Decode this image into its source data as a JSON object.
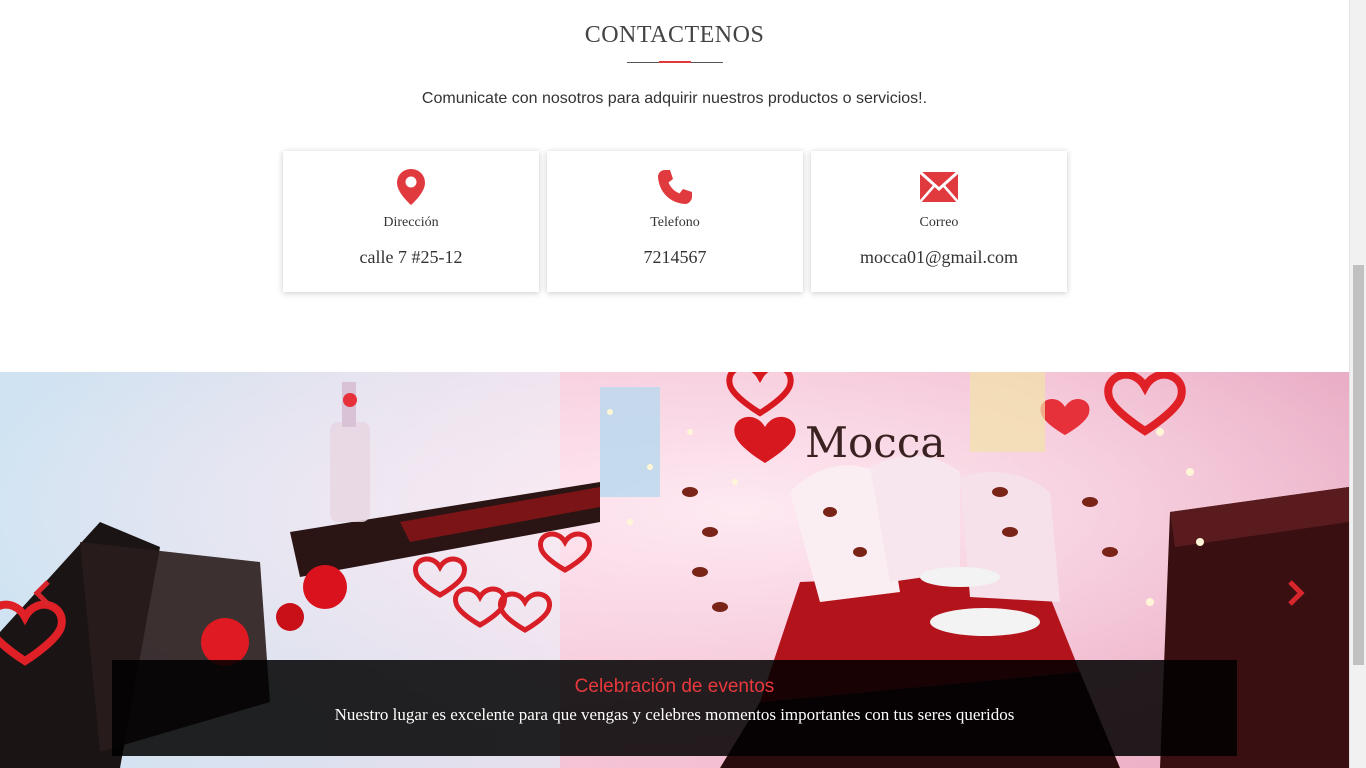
{
  "contact": {
    "title": "CONTACTENOS",
    "subtitle": "Comunicate con nosotros para adquirir nuestros productos o servicios!.",
    "accent_color": "#e03a3e",
    "cards": [
      {
        "icon": "location-pin-icon",
        "label": "Dirección",
        "value": "calle 7 #25-12"
      },
      {
        "icon": "phone-icon",
        "label": "Telefono",
        "value": "7214567"
      },
      {
        "icon": "mail-icon",
        "label": "Correo",
        "value": "mocca01@gmail.com"
      }
    ]
  },
  "carousel": {
    "slide_image": "valentine-restaurant-photo",
    "caption_title": "Celebración de eventos",
    "caption_text": "Nuestro lugar es excelente para que vengas y celebres momentos importantes con tus seres queridos",
    "prev_icon": "chevron-left-icon",
    "next_icon": "chevron-right-icon",
    "caption_title_color": "#e8383d"
  }
}
